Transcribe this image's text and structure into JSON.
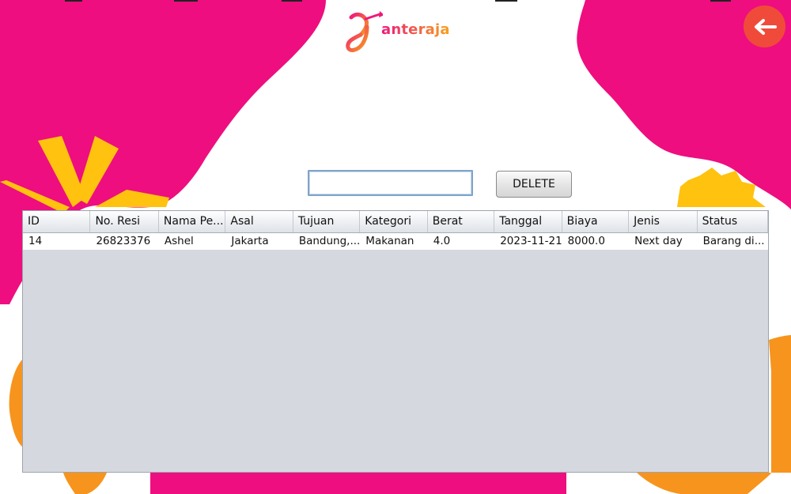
{
  "app": {
    "logo_text": "anteraja",
    "colors": {
      "pink": "#ee0e7f",
      "orange": "#f7941d",
      "yellow": "#ffc20e",
      "back_button": "#f04b3a"
    }
  },
  "back_button": {
    "icon": "arrow-left-icon"
  },
  "search": {
    "value": "",
    "placeholder": ""
  },
  "delete_button": {
    "label": "DELETE"
  },
  "table": {
    "columns": [
      "ID",
      "No. Resi",
      "Nama Pe...",
      "Asal",
      "Tujuan",
      "Kategori",
      "Berat",
      "Tanggal",
      "Biaya",
      "Jenis",
      "Status"
    ],
    "rows": [
      [
        "14",
        "26823376",
        "Ashel",
        "Jakarta",
        "Bandung,...",
        "Makanan",
        "4.0",
        "2023-11-21",
        "8000.0",
        "Next day",
        "Barang di..."
      ]
    ]
  }
}
